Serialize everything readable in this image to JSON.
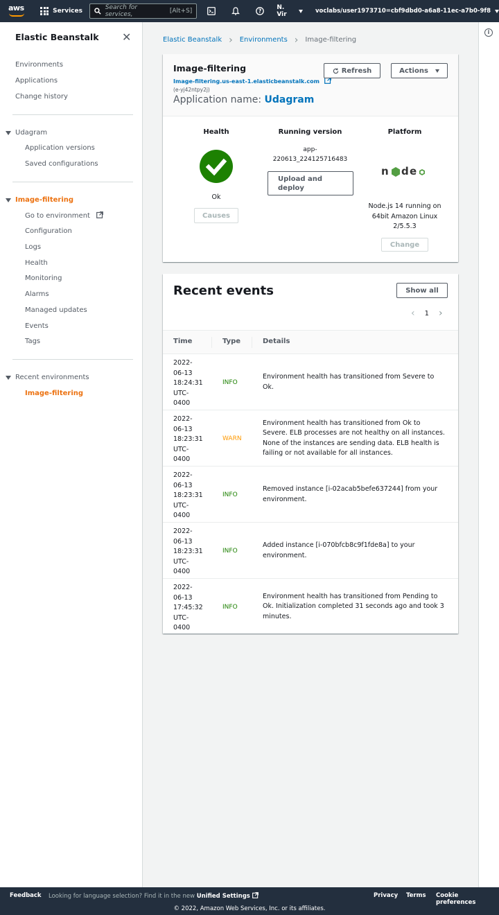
{
  "topnav": {
    "logo_text": "aws",
    "services_label": "Services",
    "search_placeholder": "Search for services,",
    "search_shortcut": "[Alt+S]",
    "region": "N. Vir",
    "account": "voclabs/user1973710=cbf9dbd0-a6a8-11ec-a7b0-9f8"
  },
  "sidebar": {
    "title": "Elastic Beanstalk",
    "top_links": [
      "Environments",
      "Applications",
      "Change history"
    ],
    "app_section": "Udagram",
    "app_links": [
      "Application versions",
      "Saved configurations"
    ],
    "env_section": "Image-filtering",
    "env_links": [
      "Go to environment",
      "Configuration",
      "Logs",
      "Health",
      "Monitoring",
      "Alarms",
      "Managed updates",
      "Events",
      "Tags"
    ],
    "recent_section": "Recent environments",
    "recent_links": [
      "Image-filtering"
    ]
  },
  "breadcrumb": [
    "Elastic Beanstalk",
    "Environments",
    "Image-filtering"
  ],
  "environment": {
    "name": "Image-filtering",
    "url": "Image-filtering.us-east-1.elasticbeanstalk.com",
    "id": "(e-yj42ntpy2j)",
    "app_name_label": "Application name:",
    "app_name": "Udagram",
    "refresh_label": "Refresh",
    "actions_label": "Actions",
    "health_title": "Health",
    "health_status": "Ok",
    "causes_label": "Causes",
    "version_title": "Running version",
    "version_line1": "app-",
    "version_line2": "220613_224125716483",
    "upload_label_1": "Upload and",
    "upload_label_2": "deploy",
    "platform_title": "Platform",
    "platform_line1": "Node.js 14 running on",
    "platform_line2": "64bit Amazon Linux",
    "platform_line3": "2/5.5.3",
    "change_label": "Change"
  },
  "events": {
    "title": "Recent events",
    "show_all_label": "Show all",
    "page": "1",
    "columns": [
      "Time",
      "Type",
      "Details"
    ],
    "rows": [
      {
        "t": [
          "2022-",
          "06-13",
          "18:24:31",
          "UTC-",
          "0400"
        ],
        "type": "INFO",
        "details": "Environment health has transitioned from Severe to Ok."
      },
      {
        "t": [
          "2022-",
          "06-13",
          "18:23:31",
          "UTC-",
          "0400"
        ],
        "type": "WARN",
        "details": "Environment health has transitioned from Ok to Severe. ELB processes are not healthy on all instances. None of the instances are sending data. ELB health is failing or not available for all instances."
      },
      {
        "t": [
          "2022-",
          "06-13",
          "18:23:31",
          "UTC-",
          "0400"
        ],
        "type": "INFO",
        "details": "Removed instance [i-02acab5befe637244] from your environment."
      },
      {
        "t": [
          "2022-",
          "06-13",
          "18:23:31",
          "UTC-",
          "0400"
        ],
        "type": "INFO",
        "details": "Added instance [i-070bfcb8c9f1fde8a] to your environment."
      },
      {
        "t": [
          "2022-",
          "06-13",
          "17:45:32",
          "UTC-",
          "0400"
        ],
        "type": "INFO",
        "details": "Environment health has transitioned from Pending to Ok. Initialization completed 31 seconds ago and took 3 minutes."
      }
    ]
  },
  "footer": {
    "feedback": "Feedback",
    "lang_text": "Looking for language selection? Find it in the new",
    "unified_settings": "Unified Settings",
    "privacy": "Privacy",
    "terms": "Terms",
    "cookies": "Cookie preferences",
    "copyright": "© 2022, Amazon Web Services, Inc. or its affiliates."
  },
  "colors": {
    "nav_bg": "#232f3e",
    "link": "#0073bb",
    "active": "#ec7211",
    "ok_green": "#1d8102",
    "warn_orange": "#ff9900"
  }
}
